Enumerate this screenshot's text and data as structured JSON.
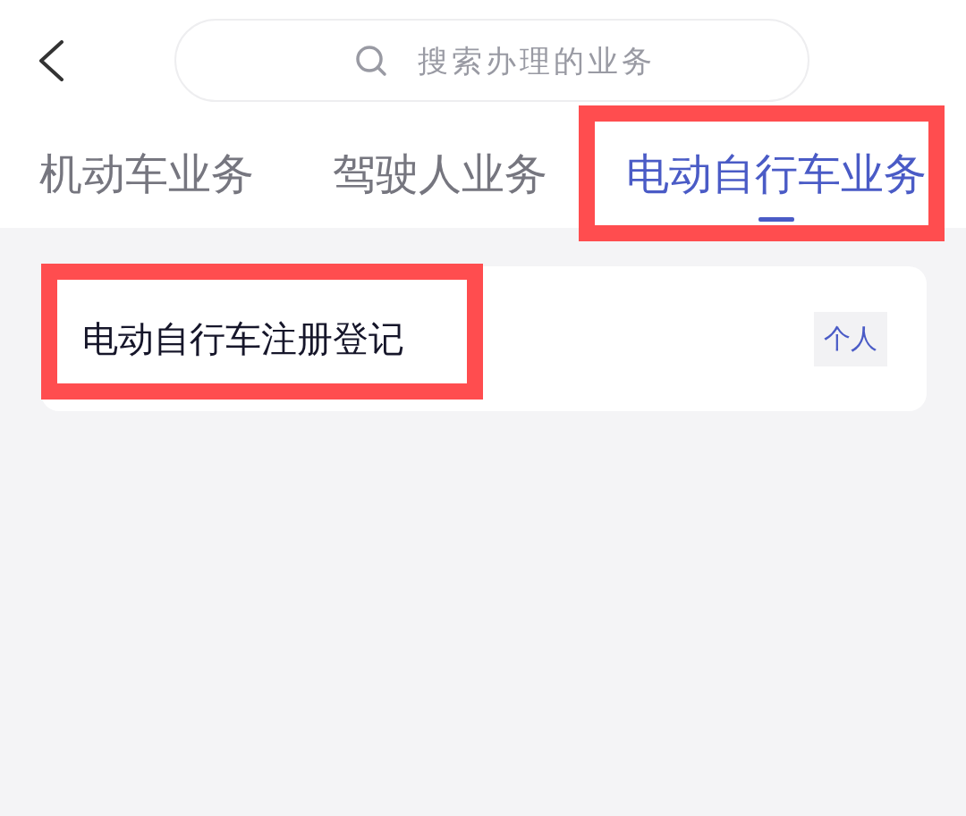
{
  "header": {
    "search": {
      "placeholder": "搜索办理的业务"
    }
  },
  "tabs": [
    {
      "label": "机动车业务",
      "selected": false,
      "highlighted": false
    },
    {
      "label": "驾驶人业务",
      "selected": false,
      "highlighted": false
    },
    {
      "label": "电动自行车业务",
      "selected": true,
      "highlighted": true
    }
  ],
  "services": [
    {
      "name": "电动自行车注册登记",
      "tag": "个人",
      "highlighted": true
    }
  ]
}
